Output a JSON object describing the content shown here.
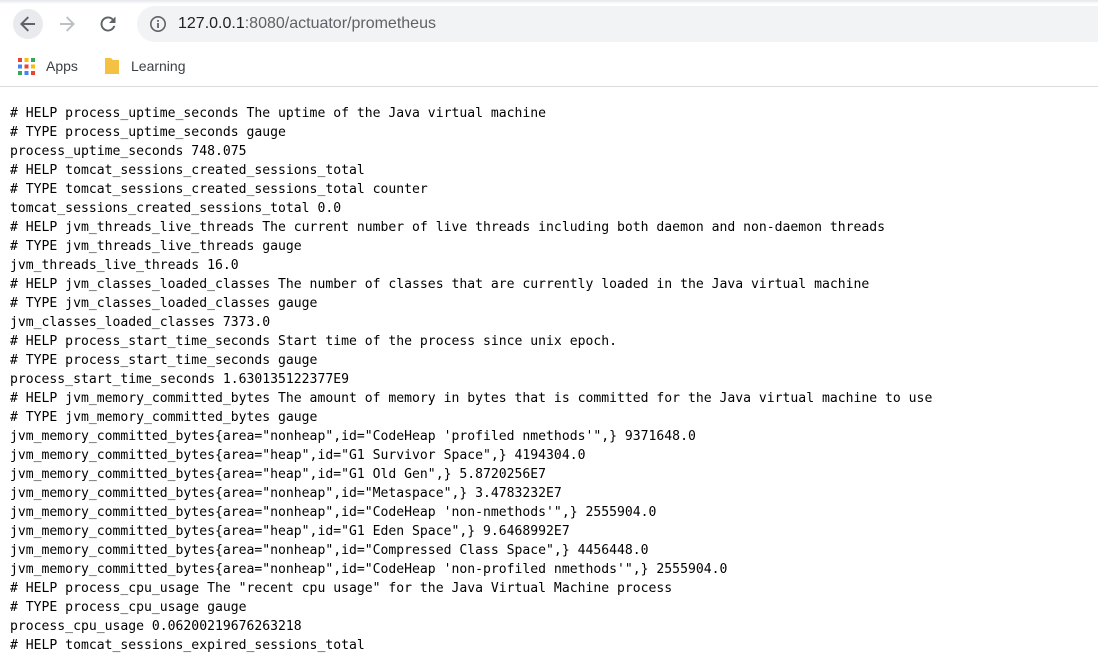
{
  "browser": {
    "nav": {
      "back_icon": "arrow-left-icon",
      "forward_icon": "arrow-right-icon",
      "reload_icon": "reload-icon"
    },
    "address": {
      "icon": "info-icon",
      "host": "127.0.0.1",
      "port_path": ":8080/actuator/prometheus"
    },
    "bookmarks": [
      {
        "label": "Apps",
        "icon": "apps-grid-icon"
      },
      {
        "label": "Learning",
        "icon": "folder-icon"
      }
    ]
  },
  "colors": {
    "omnibox_bg": "#f1f3f4",
    "apps_grid": [
      "#ea4335",
      "#fbbc04",
      "#34a853",
      "#4285f4"
    ],
    "folder": "#f5c144"
  },
  "metrics": [
    "# HELP process_uptime_seconds The uptime of the Java virtual machine",
    "# TYPE process_uptime_seconds gauge",
    "process_uptime_seconds 748.075",
    "# HELP tomcat_sessions_created_sessions_total",
    "# TYPE tomcat_sessions_created_sessions_total counter",
    "tomcat_sessions_created_sessions_total 0.0",
    "# HELP jvm_threads_live_threads The current number of live threads including both daemon and non-daemon threads",
    "# TYPE jvm_threads_live_threads gauge",
    "jvm_threads_live_threads 16.0",
    "# HELP jvm_classes_loaded_classes The number of classes that are currently loaded in the Java virtual machine",
    "# TYPE jvm_classes_loaded_classes gauge",
    "jvm_classes_loaded_classes 7373.0",
    "# HELP process_start_time_seconds Start time of the process since unix epoch.",
    "# TYPE process_start_time_seconds gauge",
    "process_start_time_seconds 1.630135122377E9",
    "# HELP jvm_memory_committed_bytes The amount of memory in bytes that is committed for the Java virtual machine to use",
    "# TYPE jvm_memory_committed_bytes gauge",
    "jvm_memory_committed_bytes{area=\"nonheap\",id=\"CodeHeap 'profiled nmethods'\",} 9371648.0",
    "jvm_memory_committed_bytes{area=\"heap\",id=\"G1 Survivor Space\",} 4194304.0",
    "jvm_memory_committed_bytes{area=\"heap\",id=\"G1 Old Gen\",} 5.8720256E7",
    "jvm_memory_committed_bytes{area=\"nonheap\",id=\"Metaspace\",} 3.4783232E7",
    "jvm_memory_committed_bytes{area=\"nonheap\",id=\"CodeHeap 'non-nmethods'\",} 2555904.0",
    "jvm_memory_committed_bytes{area=\"heap\",id=\"G1 Eden Space\",} 9.6468992E7",
    "jvm_memory_committed_bytes{area=\"nonheap\",id=\"Compressed Class Space\",} 4456448.0",
    "jvm_memory_committed_bytes{area=\"nonheap\",id=\"CodeHeap 'non-profiled nmethods'\",} 2555904.0",
    "# HELP process_cpu_usage The \"recent cpu usage\" for the Java Virtual Machine process",
    "# TYPE process_cpu_usage gauge",
    "process_cpu_usage 0.06200219676263218",
    "# HELP tomcat_sessions_expired_sessions_total"
  ]
}
